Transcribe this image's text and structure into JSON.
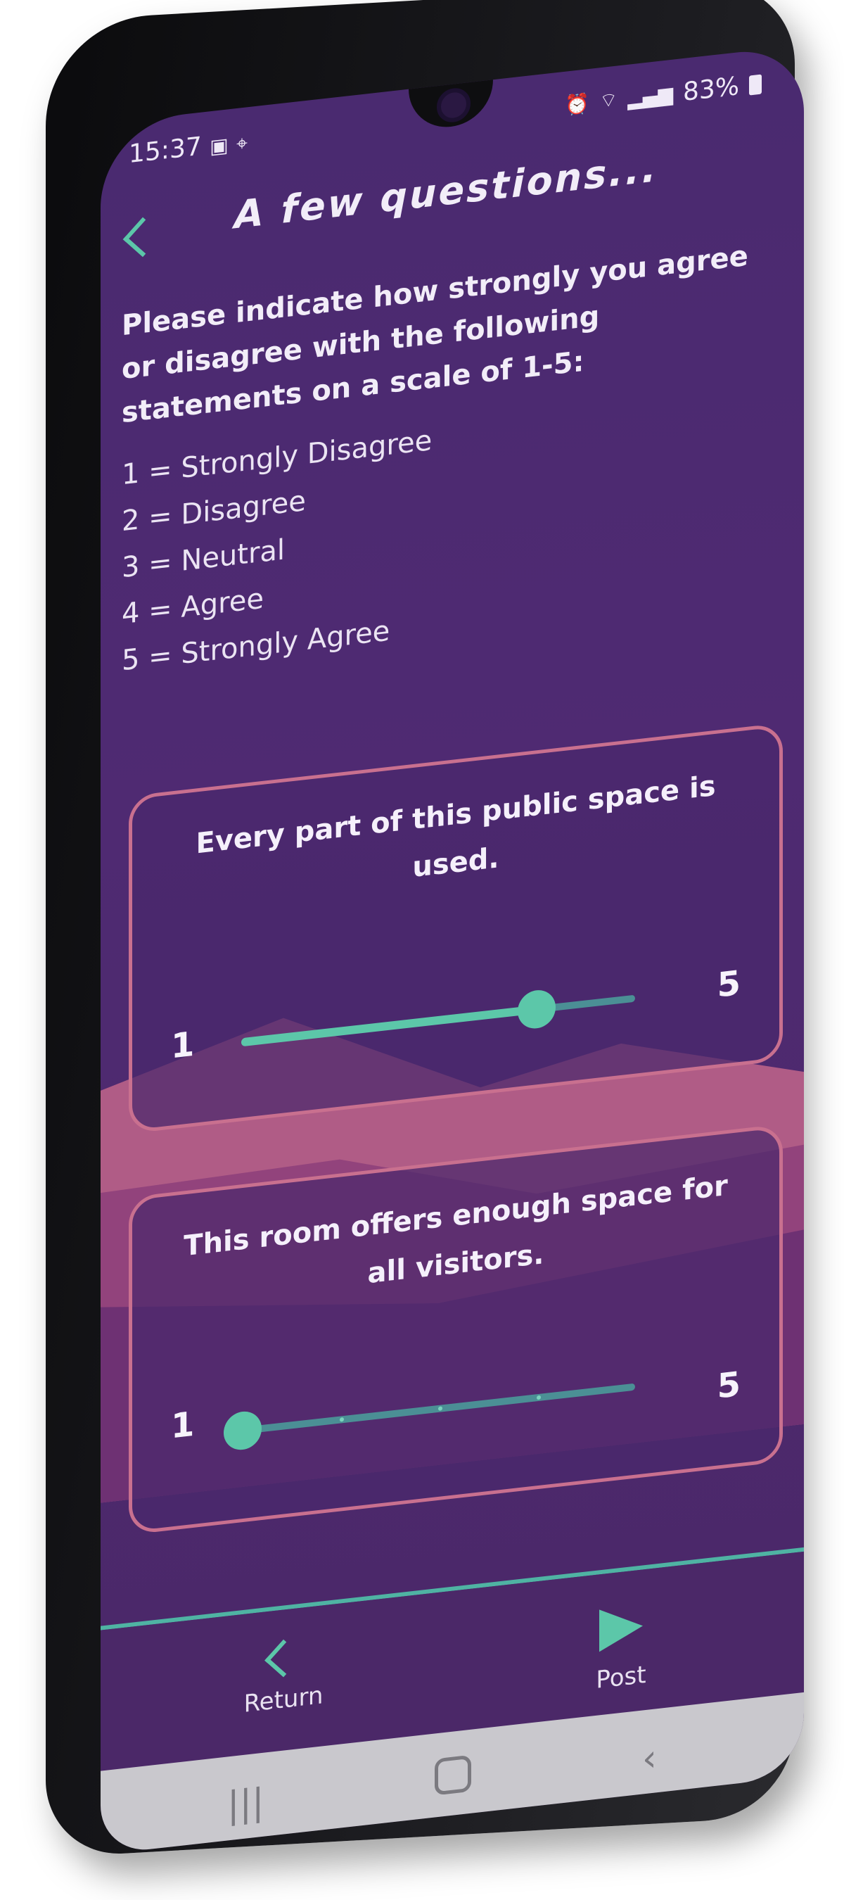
{
  "status_bar": {
    "time": "15:37",
    "left_icons": [
      "image-icon",
      "location-icon"
    ],
    "right_icons": [
      "alarm-icon",
      "wifi-icon",
      "signal-icon"
    ],
    "battery": "83%"
  },
  "header": {
    "back_icon": "chevron-left-icon",
    "title": "A few questions..."
  },
  "intro_text": "Please indicate how strongly you agree or disagree with the following statements on a scale of 1-5:",
  "scale_legend": [
    "1 = Strongly Disagree",
    "2 = Disagree",
    "3 = Neutral",
    "4 = Agree",
    "5 = Strongly Agree"
  ],
  "questions": [
    {
      "text": "Every part of this public space is used.",
      "min_label": "1",
      "max_label": "5",
      "value": 4
    },
    {
      "text": "This room offers enough space for all visitors.",
      "min_label": "1",
      "max_label": "5",
      "value": 1
    }
  ],
  "bottom_nav": {
    "return_label": "Return",
    "post_label": "Post"
  },
  "colors": {
    "background": "#4f2a72",
    "accent": "#5cc7a9",
    "card_border": "#c9708f",
    "mountain_pink": "#c8688c"
  }
}
